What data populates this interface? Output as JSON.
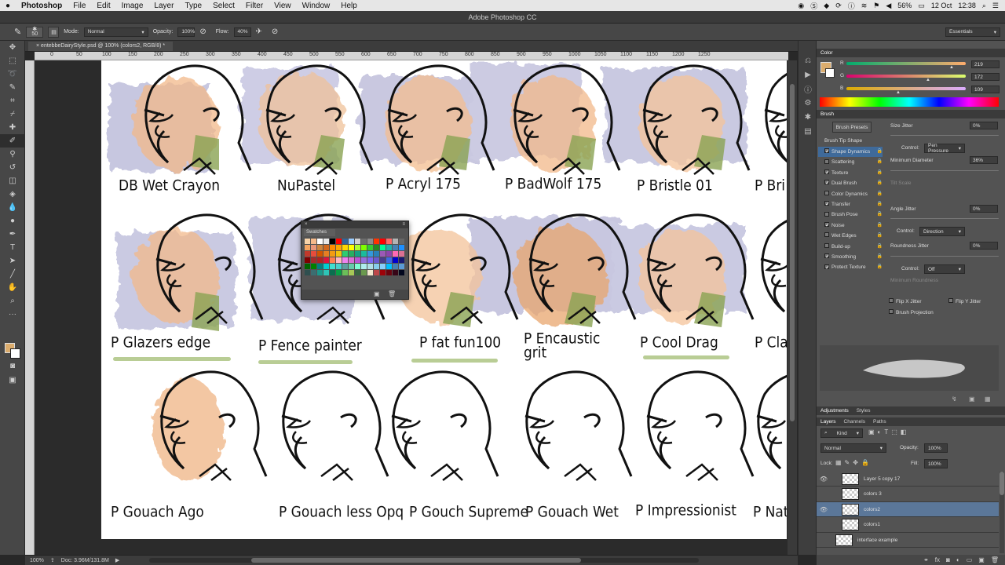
{
  "menubar": {
    "apple": "",
    "app": "Photoshop",
    "items": [
      "File",
      "Edit",
      "Image",
      "Layer",
      "Type",
      "Select",
      "Filter",
      "View",
      "Window",
      "Help"
    ],
    "battery": "56%",
    "date": "12 Oct",
    "time": "12:38"
  },
  "window_title": "Adobe Photoshop CC",
  "options": {
    "brush_size": "50",
    "mode_label": "Mode:",
    "mode": "Normal",
    "opacity_label": "Opacity:",
    "opacity": "100%",
    "flow_label": "Flow:",
    "flow": "40%",
    "workspace": "Essentials"
  },
  "doc_tab": "entebbeDairyStyle.psd @ 100% (colors2, RGB/8) *",
  "ruler_labels": [
    "0",
    "50",
    "100",
    "150",
    "200",
    "250",
    "300",
    "350",
    "400",
    "450",
    "500",
    "550",
    "600",
    "650",
    "700",
    "750",
    "800",
    "850",
    "900",
    "950",
    "1000",
    "1050",
    "1100",
    "1150",
    "1200",
    "1250"
  ],
  "canvas_labels": [
    "DB Wet Crayon",
    "NuPastel",
    "P Acryl 175",
    "P BadWolf 175",
    "P Bristle 01",
    "P Bri",
    "P Glazers edge",
    "P Fence painter",
    "P fat fun100",
    "P Encaustic grit",
    "P Cool Drag",
    "P Cla",
    "P Gouach Ago",
    "P Gouach less Opq",
    "P Gouch Supreme",
    "P Gouach Wet",
    "P Impressionist",
    "P Natu"
  ],
  "swatches": {
    "title": "Swatches",
    "colors": [
      "#f7d2a8",
      "#f5b98a",
      "#ffffff",
      "#e8e8e8",
      "#000000",
      "#ff0000",
      "#336699",
      "#99ccff",
      "#cfcfcf",
      "#6d6d6d",
      "#8c8c8c",
      "#ff3300",
      "#ff0000",
      "#ff6666",
      "#b3b3b3",
      "#666666",
      "#f4a460",
      "#e9967a",
      "#cd853f",
      "#d2691e",
      "#ff8c00",
      "#ffa500",
      "#ffd700",
      "#ffff00",
      "#adff2f",
      "#7fff00",
      "#32cd32",
      "#228b22",
      "#00fa9a",
      "#20b2aa",
      "#4682b4",
      "#1e90ff",
      "#c0392b",
      "#e74c3c",
      "#d35400",
      "#e67e22",
      "#f39c12",
      "#f1c40f",
      "#2ecc71",
      "#27ae60",
      "#16a085",
      "#1abc9c",
      "#3498db",
      "#2980b9",
      "#9b59b6",
      "#8e44ad",
      "#ff69b4",
      "#db7093",
      "#800000",
      "#a52a2a",
      "#b22222",
      "#dc143c",
      "#ff7f50",
      "#ffb6c1",
      "#ee82ee",
      "#da70d6",
      "#ba55d3",
      "#9370db",
      "#7b68ee",
      "#6a5acd",
      "#483d8b",
      "#4169e1",
      "#0000cd",
      "#191970",
      "#006400",
      "#008000",
      "#008080",
      "#00ced1",
      "#40e0d0",
      "#48d1cc",
      "#5f9ea0",
      "#66cdaa",
      "#7fffd4",
      "#afeeee",
      "#b0e0e6",
      "#87ceeb",
      "#87cefa",
      "#00bfff",
      "#4682b4",
      "#5b9bd5",
      "#2f4f4f",
      "#3c6e71",
      "#1b998b",
      "#2ec4b6",
      "#0b6e4f",
      "#08a045",
      "#6bbf59",
      "#a7c957",
      "#386641",
      "#6a994e",
      "#f2e8cf",
      "#bc4749",
      "#9d0208",
      "#6a040f",
      "#370617",
      "#03071e"
    ]
  },
  "color_panel": {
    "title": "Color",
    "r_label": "R",
    "g_label": "G",
    "b_label": "B",
    "r": "219",
    "g": "172",
    "b": "109"
  },
  "brush_panel": {
    "title": "Brush",
    "presets_btn": "Brush Presets",
    "tip_shape": "Brush Tip Shape",
    "options": [
      {
        "label": "Shape Dynamics",
        "on": true
      },
      {
        "label": "Scattering",
        "on": false
      },
      {
        "label": "Texture",
        "on": true
      },
      {
        "label": "Dual Brush",
        "on": true
      },
      {
        "label": "Color Dynamics",
        "on": false
      },
      {
        "label": "Transfer",
        "on": true
      },
      {
        "label": "Brush Pose",
        "on": false
      },
      {
        "label": "Noise",
        "on": true
      },
      {
        "label": "Wet Edges",
        "on": false
      },
      {
        "label": "Build-up",
        "on": false
      },
      {
        "label": "Smoothing",
        "on": true
      },
      {
        "label": "Protect Texture",
        "on": true
      }
    ],
    "size_jitter_label": "Size Jitter",
    "size_jitter": "0%",
    "control_label": "Control:",
    "control1": "Pen Pressure",
    "min_diameter_label": "Minimum Diameter",
    "min_diameter": "36%",
    "tilt_scale_label": "Tilt Scale",
    "angle_jitter_label": "Angle Jitter",
    "angle_jitter": "0%",
    "control2": "Direction",
    "roundness_jitter_label": "Roundness Jitter",
    "roundness_jitter": "0%",
    "control3": "Off",
    "min_roundness_label": "Minimum Roundness",
    "flip_x": "Flip X Jitter",
    "flip_y": "Flip Y Jitter",
    "brush_projection": "Brush Projection"
  },
  "adjust_tabs": [
    "Adjustments",
    "Styles"
  ],
  "layers_tabs": [
    "Layers",
    "Channels",
    "Paths"
  ],
  "layers_panel": {
    "kind": "Kind",
    "blend": "Normal",
    "opacity_label": "Opacity:",
    "opacity": "100%",
    "lock_label": "Lock:",
    "fill_label": "Fill:",
    "fill": "100%",
    "layers": [
      {
        "name": "Layer 5 copy 17",
        "visible": true,
        "selected": false
      },
      {
        "name": "colors 3",
        "visible": false,
        "selected": false
      },
      {
        "name": "colors2",
        "visible": true,
        "selected": true
      },
      {
        "name": "colors1",
        "visible": false,
        "selected": false
      },
      {
        "name": "interface example",
        "visible": false,
        "selected": false
      }
    ]
  },
  "status": {
    "zoom": "100%",
    "doc": "Doc: 3.96M/131.8M"
  }
}
